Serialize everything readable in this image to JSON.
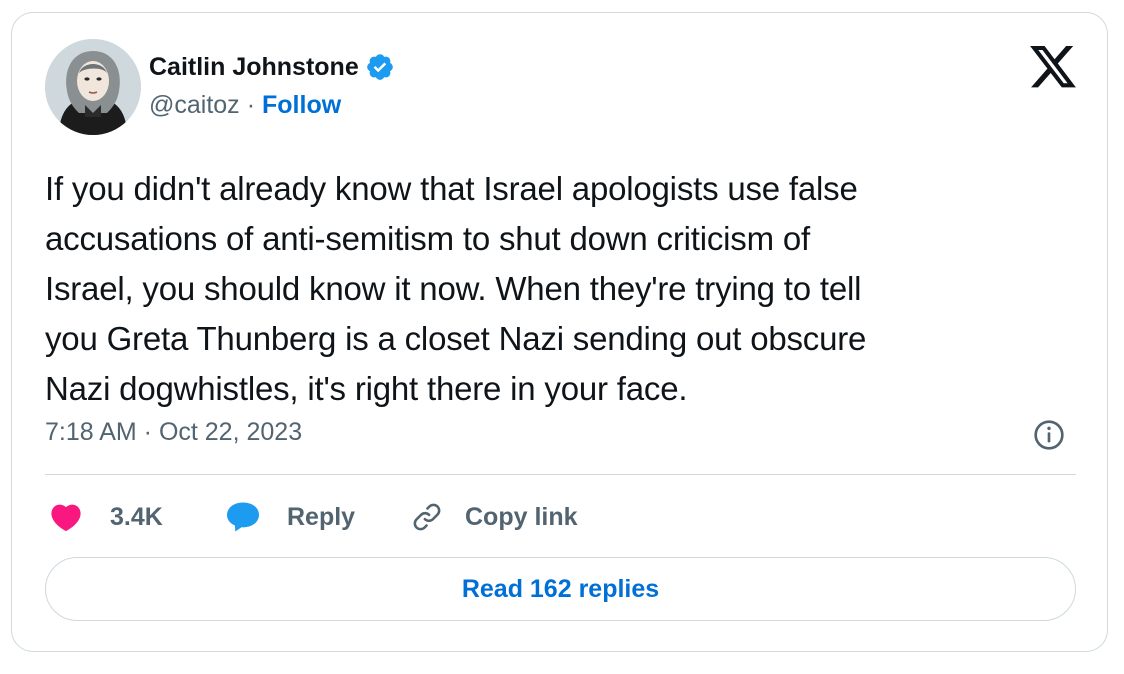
{
  "author": {
    "name": "Caitlin Johnstone",
    "handle": "@caitoz",
    "separator": "·",
    "follow_label": "Follow",
    "verified_icon": "verified-badge-icon",
    "avatar_icon": "avatar-illustration"
  },
  "brand": {
    "logo_icon": "x-logo-icon"
  },
  "tweet": {
    "lines": [
      "If you didn't already know that Israel apologists use false",
      "accusations of anti-semitism to shut down criticism of",
      "Israel, you should know it now. When they're trying to tell",
      "you Greta Thunberg is a closet Nazi sending out obscure",
      "Nazi dogwhistles, it's right there in your face."
    ],
    "timestamp": "7:18 AM · Oct 22, 2023",
    "info_icon": "info-icon"
  },
  "actions": {
    "like_count": "3.4K",
    "like_icon": "heart-icon",
    "reply_label": "Reply",
    "reply_icon": "speech-bubble-icon",
    "copy_label": "Copy link",
    "copy_icon": "link-icon"
  },
  "read_replies_label": "Read 162 replies",
  "colors": {
    "text": "#0f1419",
    "secondary": "#536471",
    "link": "#006fd6",
    "heart": "#f91880",
    "reply_bubble": "#1d9bf0",
    "verified": "#1d9bf0",
    "border": "#cfd9de"
  }
}
